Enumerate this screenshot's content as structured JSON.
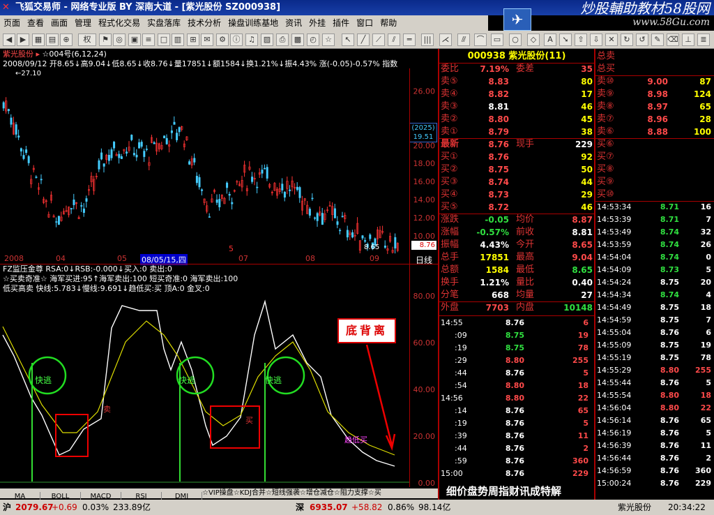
{
  "window": {
    "title": "飞狐交易师 - 网络专业版 BY 深南大道 - [紫光股份 SZ000938]",
    "brand1": "炒股輔助教材58股网",
    "brand2": "www.58Gu.com"
  },
  "menu": [
    "页面",
    "查看",
    "画面",
    "管理",
    "程式化交易",
    "实盘落库",
    "技术分析",
    "操盘训练基地",
    "资讯",
    "外挂",
    "插件",
    "窗口",
    "帮助"
  ],
  "toolbar": {
    "weight_label": "权"
  },
  "kline": {
    "stock_label": "紫光股份",
    "period": "☆004号(6,12,24)",
    "info": "2008/09/12 开8.65↓高9.04↓低8.65↓收8.76↓量17851↓额1584↓换1.21%↓振4.43% 涨(-0.05)-0.57% 指数",
    "high_mark": "27.10",
    "low_mark": "8.65",
    "cursor_year": "(2025)",
    "cursor_price": "19.51",
    "last_price": "8.76",
    "unit": "日线",
    "price_ticks": [
      "26.00",
      "22.00",
      "20.00",
      "18.00",
      "16.00",
      "14.00",
      "12.00",
      "10.00"
    ],
    "date_labels": [
      "2008",
      "04",
      "05",
      "08/05/15,四",
      "07",
      "08",
      "09"
    ],
    "marker": "5"
  },
  "indicator": {
    "line1": "FZ监压金尊 RSA:0↓RSB:-0.000↓买入:0 卖出:0",
    "line2": "☆买卖奇准☆ 海军买进:95↑海军卖出:100 短买奇准:0 海军卖出:100",
    "line3": "低买高卖 快线:5.783↓慢线:9.691↓趋低买:买 顶A:0 金叉:0",
    "ticks": [
      "80.00",
      "60.00",
      "40.00",
      "20.00",
      "0.00"
    ],
    "labels": {
      "kuaitao": "快逃",
      "dibeili": "底背离",
      "mai": "卖",
      "mai2": "买",
      "qudimai": "趋低买"
    }
  },
  "tabs": [
    "MA",
    "BOLL",
    "MACD",
    "RSI",
    "DMI"
  ],
  "scroll_text": "☆VIP操盘☆KDJ合并☆短线强袭☆增仓减仓☆阻力支撑☆买",
  "quote": {
    "code": "000938",
    "name": "紫光股份(11)",
    "webi": "7.19%",
    "weicha": "35",
    "sell": [
      [
        "卖⑤",
        "8.83",
        "80"
      ],
      [
        "卖④",
        "8.82",
        "17"
      ],
      [
        "卖③",
        "8.81",
        "46"
      ],
      [
        "卖②",
        "8.80",
        "45"
      ],
      [
        "卖①",
        "8.79",
        "38"
      ]
    ],
    "latest": "8.76",
    "xianshou": "229",
    "buy": [
      [
        "买①",
        "8.76",
        "92"
      ],
      [
        "买②",
        "8.75",
        "50"
      ],
      [
        "买③",
        "8.74",
        "44"
      ],
      [
        "买④",
        "8.73",
        "29"
      ],
      [
        "买⑤",
        "8.72",
        "46"
      ]
    ],
    "stats": [
      [
        "涨跌",
        "-0.05",
        "均价",
        "8.87"
      ],
      [
        "涨幅",
        "-0.57%",
        "前收",
        "8.81"
      ],
      [
        "振幅",
        "4.43%",
        "今开",
        "8.65"
      ],
      [
        "总手",
        "17851",
        "最高",
        "9.04"
      ],
      [
        "总额",
        "1584",
        "最低",
        "8.65"
      ],
      [
        "换手",
        "1.21%",
        "量比",
        "0.40"
      ],
      [
        "分笔",
        "668",
        "均量",
        "27"
      ]
    ],
    "waipan": "7703",
    "neipan": "10148",
    "ticks": [
      [
        "14:55",
        "8.76",
        "6"
      ],
      [
        ":09",
        "8.75",
        "19"
      ],
      [
        ":19",
        "8.75",
        "78"
      ],
      [
        ":29",
        "8.80",
        "255"
      ],
      [
        ":44",
        "8.76",
        "5"
      ],
      [
        ":54",
        "8.80",
        "18"
      ],
      [
        "14:56",
        "8.80",
        "22"
      ],
      [
        ":14",
        "8.76",
        "65"
      ],
      [
        ":19",
        "8.76",
        "5"
      ],
      [
        ":39",
        "8.76",
        "11"
      ],
      [
        ":44",
        "8.76",
        "2"
      ],
      [
        ":59",
        "8.76",
        "360"
      ],
      [
        "15:00",
        "8.76",
        "229"
      ]
    ],
    "footer": "细价盘势周指财讯成特解"
  },
  "level2": {
    "total_sell": "总卖",
    "total_buy": "总买",
    "sell": [
      [
        "卖⑩",
        "9.00",
        "87"
      ],
      [
        "卖⑨",
        "8.98",
        "124"
      ],
      [
        "卖⑧",
        "8.97",
        "65"
      ],
      [
        "卖⑦",
        "8.96",
        "28"
      ],
      [
        "卖⑥",
        "8.88",
        "100"
      ]
    ],
    "buy": [
      "买⑥",
      "买⑦",
      "买⑧",
      "买⑨",
      "买⑩"
    ],
    "ticks": [
      [
        "14:53:34",
        "8.71",
        "16"
      ],
      [
        "14:53:39",
        "8.71",
        "7"
      ],
      [
        "14:53:49",
        "8.74",
        "32"
      ],
      [
        "14:53:59",
        "8.74",
        "26"
      ],
      [
        "14:54:04",
        "8.74",
        "0"
      ],
      [
        "14:54:09",
        "8.73",
        "5"
      ],
      [
        "14:54:24",
        "8.75",
        "20"
      ],
      [
        "14:54:34",
        "8.74",
        "4"
      ],
      [
        "14:54:49",
        "8.75",
        "18"
      ],
      [
        "14:54:59",
        "8.75",
        "7"
      ],
      [
        "14:55:04",
        "8.76",
        "6"
      ],
      [
        "14:55:09",
        "8.75",
        "19"
      ],
      [
        "14:55:19",
        "8.75",
        "78"
      ],
      [
        "14:55:29",
        "8.80",
        "255"
      ],
      [
        "14:55:44",
        "8.76",
        "5"
      ],
      [
        "14:55:54",
        "8.80",
        "18"
      ],
      [
        "14:56:04",
        "8.80",
        "22"
      ],
      [
        "14:56:14",
        "8.76",
        "65"
      ],
      [
        "14:56:19",
        "8.76",
        "5"
      ],
      [
        "14:56:39",
        "8.76",
        "11"
      ],
      [
        "14:56:44",
        "8.76",
        "2"
      ],
      [
        "14:56:59",
        "8.76",
        "360"
      ],
      [
        "15:00:24",
        "8.76",
        "229"
      ]
    ]
  },
  "status": {
    "sh_label": "沪",
    "sh_index": "2079.67",
    "sh_chg": "+0.69",
    "sh_pct": "0.03%",
    "sh_amt": "233.89亿",
    "sz_label": "深",
    "sz_index": "6935.07",
    "sz_chg": "+58.82",
    "sz_pct": "0.86%",
    "sz_amt": "98.14亿",
    "stock": "紫光股份",
    "time": "20:34:22"
  }
}
